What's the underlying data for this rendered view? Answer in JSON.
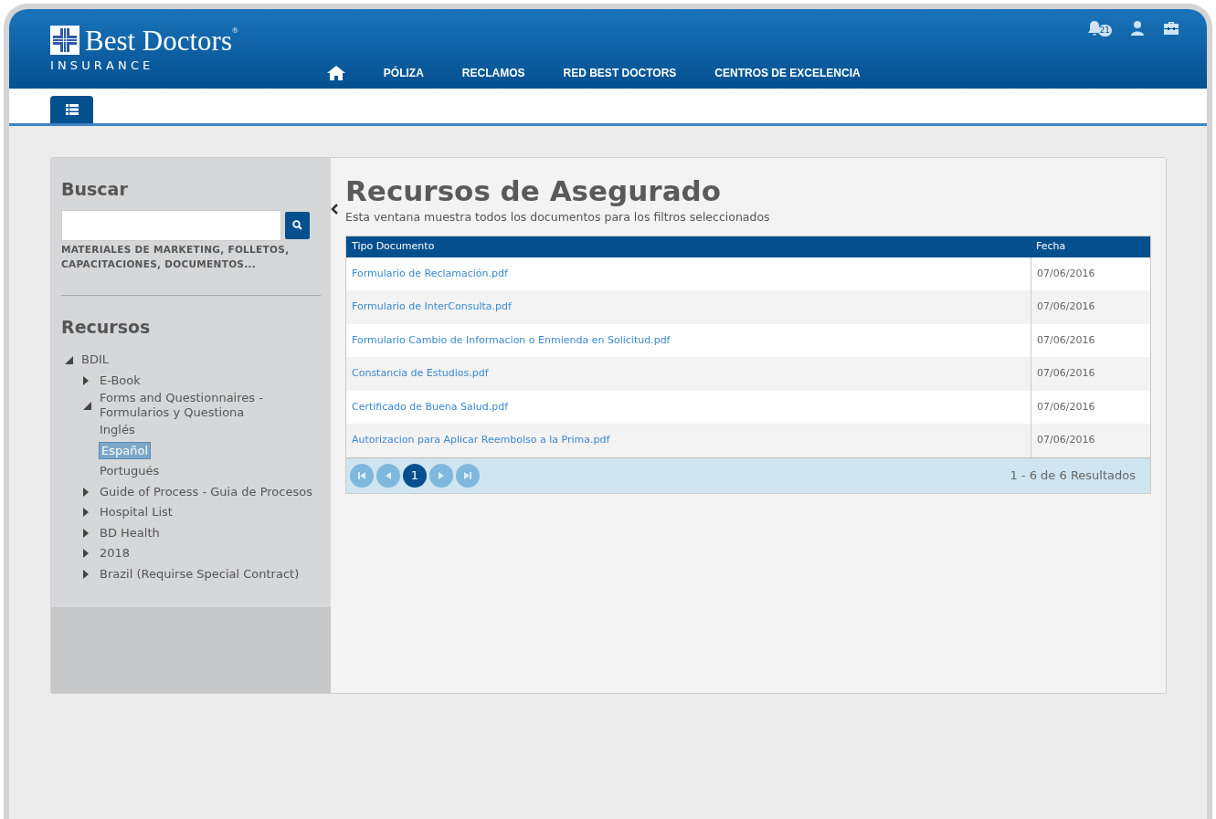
{
  "logo": {
    "name": "Best Doctors",
    "registered": "®",
    "tagline": "I N S U R A N C E"
  },
  "nav": [
    {
      "label": "PÓLIZA"
    },
    {
      "label": "RECLAMOS"
    },
    {
      "label": "RED BEST DOCTORS"
    },
    {
      "label": "CENTROS DE EXCELENCIA"
    }
  ],
  "notifications": {
    "count": "21"
  },
  "search": {
    "title": "Buscar",
    "hint": "MATERIALES DE MARKETING, FOLLETOS, CAPACITACIONES, DOCUMENTOS..."
  },
  "resources": {
    "title": "Recursos",
    "tree": [
      {
        "label": "BDIL",
        "expanded": true,
        "selected": false,
        "children": [
          {
            "label": "E-Book",
            "expanded": false,
            "selected": false
          },
          {
            "label": "Forms and Questionnaires - Formularios y Questiona",
            "expanded": true,
            "selected": false,
            "children": [
              {
                "label": "Inglés",
                "selected": false
              },
              {
                "label": "Español",
                "selected": true
              },
              {
                "label": "Portugués",
                "selected": false
              }
            ]
          },
          {
            "label": "Guide of Process - Guia de Procesos",
            "expanded": false,
            "selected": false
          },
          {
            "label": "Hospital List",
            "expanded": false,
            "selected": false
          },
          {
            "label": "BD Health",
            "expanded": false,
            "selected": false
          },
          {
            "label": "2018",
            "expanded": false,
            "selected": false
          },
          {
            "label": "Brazil (Requirse Special Contract)",
            "expanded": false,
            "selected": false
          }
        ]
      }
    ]
  },
  "main": {
    "title": "Recursos de Asegurado",
    "subtitle": "Esta ventana muestra todos los documentos para los filtros seleccionados",
    "table": {
      "columns": [
        "Tipo Documento",
        "Fecha"
      ],
      "rows": [
        [
          "Formulario de Reclamación.pdf",
          "07/06/2016"
        ],
        [
          "Formulario de InterConsulta.pdf",
          "07/06/2016"
        ],
        [
          "Formulario Cambio de Informacion o Enmienda en Solicitud.pdf",
          "07/06/2016"
        ],
        [
          "Constancia de Estudios.pdf",
          "07/06/2016"
        ],
        [
          "Certificado de Buena Salud.pdf",
          "07/06/2016"
        ],
        [
          "Autorizacion para Aplicar Reembolso a la Prima.pdf",
          "07/06/2016"
        ]
      ]
    },
    "pager": {
      "pages": [
        {
          "label": "1",
          "selected": true
        }
      ],
      "summary": "1 - 6 de 6 Resultados"
    }
  }
}
